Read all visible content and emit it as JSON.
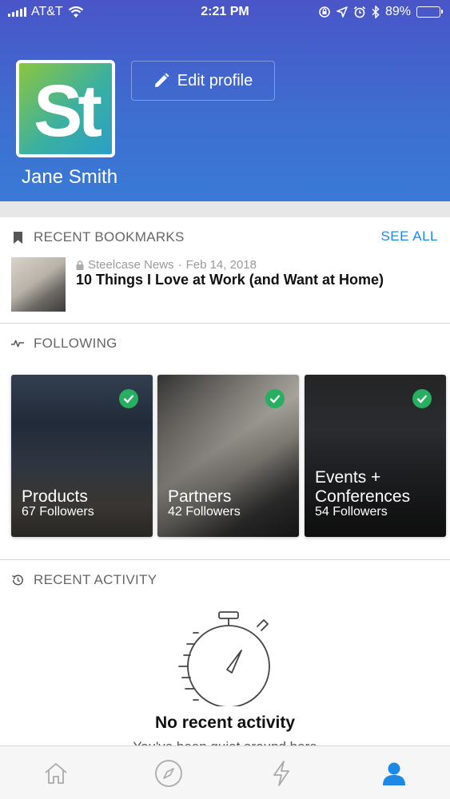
{
  "status_bar": {
    "carrier": "AT&T",
    "time": "2:21 PM",
    "battery": "89%",
    "battery_level": 0.89
  },
  "profile": {
    "logo_text": "St",
    "edit_label": "Edit profile",
    "name": "Jane Smith"
  },
  "bookmarks": {
    "heading": "RECENT BOOKMARKS",
    "see_all": "SEE ALL",
    "item": {
      "source": "Steelcase News",
      "date": "Feb 14, 2018",
      "title": "10 Things I Love at Work (and Want at Home)"
    }
  },
  "following": {
    "heading": "FOLLOWING",
    "cards": [
      {
        "title": "Products",
        "followers": "67 Followers"
      },
      {
        "title": "Partners",
        "followers": "42 Followers"
      },
      {
        "title_line1": "Events +",
        "title_line2": "Conferences",
        "followers": "54 Followers"
      }
    ]
  },
  "activity": {
    "heading": "RECENT ACTIVITY",
    "empty_title": "No recent activity",
    "empty_subtitle": "You've been quiet around here"
  },
  "tabbar": {
    "tabs": [
      {
        "icon": "home-icon",
        "active": false
      },
      {
        "icon": "compass-icon",
        "active": false
      },
      {
        "icon": "lightning-icon",
        "active": false
      },
      {
        "icon": "profile-icon",
        "active": true
      }
    ],
    "active_color": "#1e88e5"
  },
  "colors": {
    "accent": "#1e88e5",
    "header_start": "#4a55c8",
    "header_end": "#3a7ad6",
    "check": "#27ae60"
  }
}
